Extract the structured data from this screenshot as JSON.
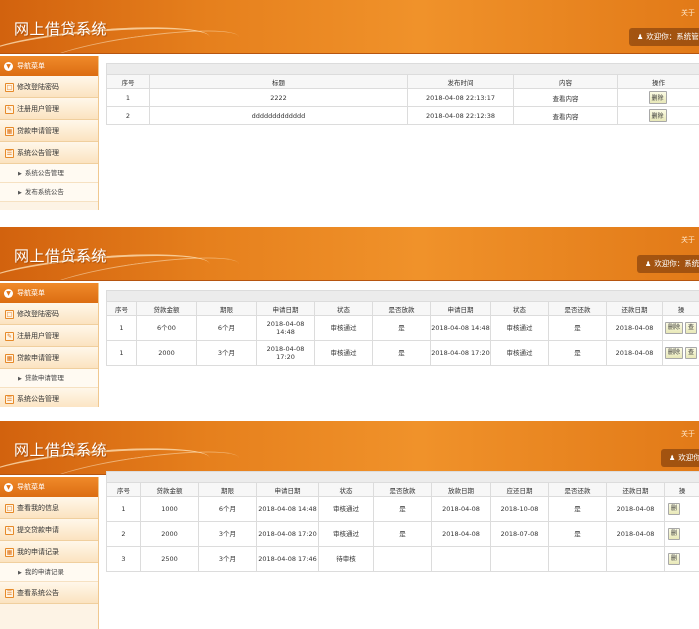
{
  "app_title": "网上借贷系统",
  "about_text": "关于",
  "welcome_text": "欢迎你：系统管理员",
  "nav_title": "导航菜单",
  "panel1": {
    "menu": [
      "修改登陆密码",
      "注册用户管理",
      "贷款申请管理",
      "系统公告管理"
    ],
    "submenu": [
      "系统公告管理",
      "发布系统公告"
    ],
    "headers": [
      "序号",
      "标题",
      "发布时间",
      "内容",
      "操作"
    ],
    "rows": [
      [
        "1",
        "2222",
        "2018-04-08 22:13:17",
        "查看内容"
      ],
      [
        "2",
        "ddddddddddddd",
        "2018-04-08 22:12:38",
        "查看内容"
      ]
    ],
    "delete_label": "删除"
  },
  "panel2": {
    "menu": [
      "修改登陆密码",
      "注册用户管理",
      "贷款申请管理"
    ],
    "submenu": [
      "贷款申请管理"
    ],
    "menu_last": "系统公告管理",
    "headers": [
      "序号",
      "贷款金额",
      "期限",
      "申请日期",
      "状态",
      "是否放款",
      "申请日期",
      "状态",
      "是否还款",
      "还款日期",
      "操"
    ],
    "rows": [
      [
        "1",
        "6个00",
        "6个月",
        "2018-04-08 14:48",
        "审核通过",
        "是",
        "2018-04-08 14:48",
        "审核通过",
        "是",
        "2018-04-08"
      ],
      [
        "1",
        "2000",
        "3个月",
        "2018-04-08 17:20",
        "审核通过",
        "是",
        "2018-04-08 17:20",
        "审核通过",
        "是",
        "2018-04-08"
      ]
    ],
    "delete_label": "删除",
    "view_label": "查"
  },
  "panel3": {
    "menu": [
      "查看我的信息",
      "提交贷款申请",
      "我的申请记录"
    ],
    "submenu": [
      "我的申请记录"
    ],
    "menu_last": "查看系统公告",
    "headers": [
      "序号",
      "贷款金额",
      "期限",
      "申请日期",
      "状态",
      "是否放款",
      "放款日期",
      "应还日期",
      "是否还款",
      "还款日期",
      "操"
    ],
    "rows": [
      [
        "1",
        "1000",
        "6个月",
        "2018-04-08 14:48",
        "审核通过",
        "是",
        "2018-04-08",
        "2018-10-08",
        "是",
        "2018-04-08"
      ],
      [
        "2",
        "2000",
        "3个月",
        "2018-04-08 17:20",
        "审核通过",
        "是",
        "2018-04-08",
        "2018-07-08",
        "是",
        "2018-04-08"
      ],
      [
        "3",
        "2500",
        "3个月",
        "2018-04-08 17:46",
        "待审核",
        "",
        "",
        "",
        "",
        ""
      ]
    ],
    "op_label": "删"
  }
}
